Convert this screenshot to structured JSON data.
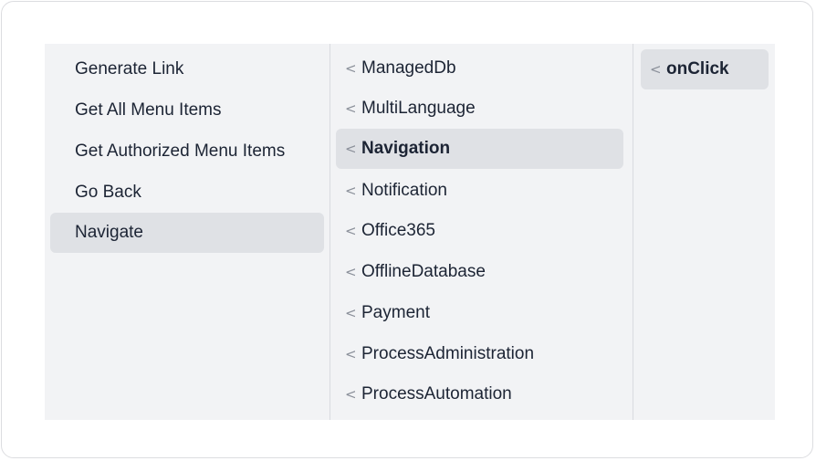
{
  "column1": {
    "items": [
      {
        "label": "Generate Link"
      },
      {
        "label": "Get All Menu Items"
      },
      {
        "label": "Get Authorized Menu Items"
      },
      {
        "label": "Go Back"
      },
      {
        "label": "Navigate",
        "selected": true
      }
    ]
  },
  "column2": {
    "chevron": "<",
    "items": [
      {
        "label": "ManagedDb"
      },
      {
        "label": "MultiLanguage"
      },
      {
        "label": "Navigation",
        "selected": true
      },
      {
        "label": "Notification"
      },
      {
        "label": "Office365"
      },
      {
        "label": "OfflineDatabase"
      },
      {
        "label": "Payment"
      },
      {
        "label": "ProcessAdministration"
      },
      {
        "label": "ProcessAutomation"
      }
    ]
  },
  "column3": {
    "chevron": "<",
    "items": [
      {
        "label": "onClick",
        "selected": true
      }
    ]
  },
  "icons": {
    "chevron": "chevron-left-icon"
  },
  "colors": {
    "panel_bg": "#f2f3f5",
    "selected_bg": "#dfe1e5",
    "text": "#1c2434",
    "chevron": "#8b909a"
  }
}
